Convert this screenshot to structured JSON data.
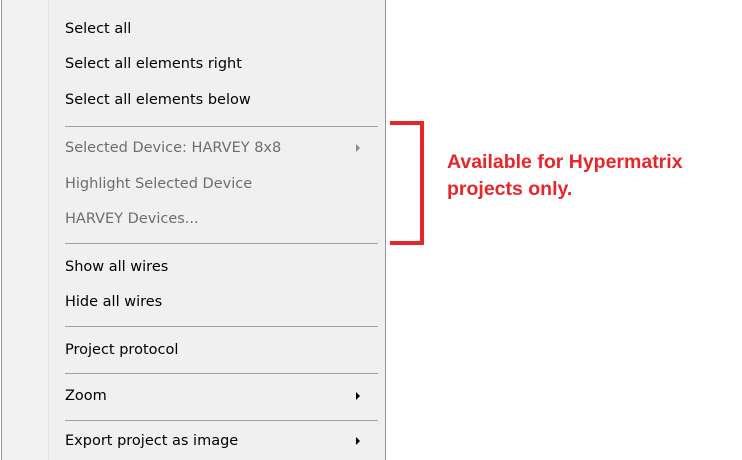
{
  "menu": {
    "groups": [
      {
        "items": [
          {
            "label": "Select all",
            "enabled": true
          },
          {
            "label": "Select all elements right",
            "enabled": true
          },
          {
            "label": "Select all elements below",
            "enabled": true
          }
        ]
      },
      {
        "items": [
          {
            "label": "Selected Device: HARVEY 8x8",
            "enabled": false,
            "submenu": true
          },
          {
            "label": "Highlight Selected Device",
            "enabled": false
          },
          {
            "label": "HARVEY Devices...",
            "enabled": false
          }
        ]
      },
      {
        "items": [
          {
            "label": "Show all wires",
            "enabled": true
          },
          {
            "label": "Hide all wires",
            "enabled": true
          }
        ]
      },
      {
        "items": [
          {
            "label": "Project protocol",
            "enabled": true
          }
        ]
      },
      {
        "items": [
          {
            "label": "Zoom",
            "enabled": true,
            "submenu": true
          }
        ]
      },
      {
        "items": [
          {
            "label": "Export project as image",
            "enabled": true,
            "submenu": true
          }
        ]
      }
    ]
  },
  "annotation": {
    "text": "Available for Hypermatrix\nprojects only.",
    "color": "#e8262a"
  },
  "icons": {
    "submenu_arrow": "chevron-right-icon",
    "bracket": "bracket-icon"
  },
  "colors": {
    "menu_background": "#f0f0f0",
    "disabled_text": "#6d6d6d",
    "separator": "#a0a0a0",
    "annotation_red": "#e8262a"
  }
}
